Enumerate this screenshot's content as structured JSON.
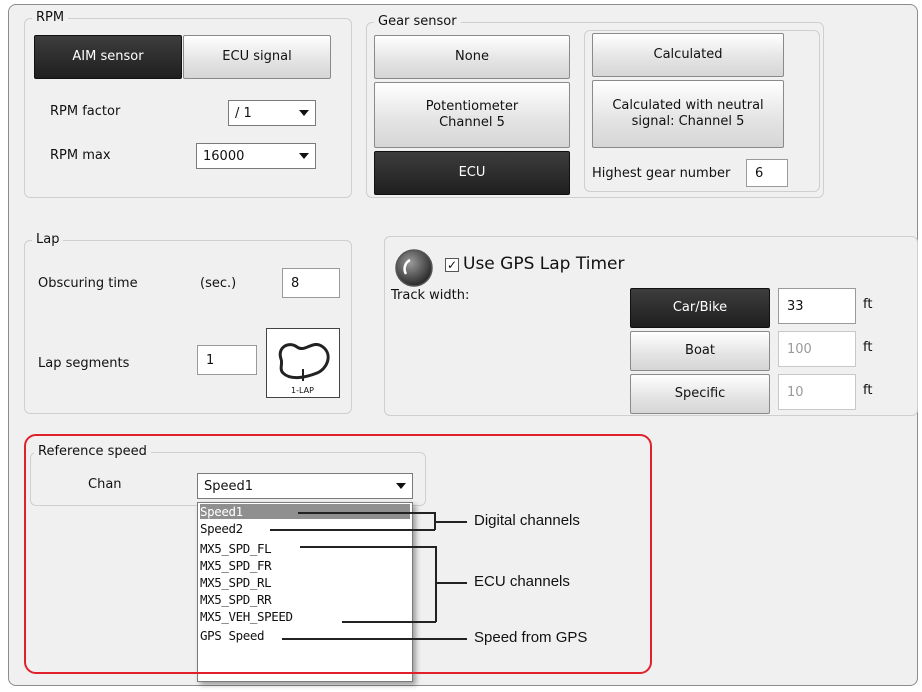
{
  "rpm": {
    "title": "RPM",
    "aim_sensor": "AIM sensor",
    "ecu_signal": "ECU signal",
    "factor_label": "RPM factor",
    "factor_value": "/ 1",
    "max_label": "RPM max",
    "max_value": "16000"
  },
  "gear": {
    "title": "Gear sensor",
    "none": "None",
    "potentiometer": "Potentiometer\nChannel 5",
    "ecu": "ECU",
    "calculated": "Calculated",
    "calculated_neutral": "Calculated with neutral\nsignal: Channel 5",
    "highest_label": "Highest gear number",
    "highest_value": "6"
  },
  "lap": {
    "title": "Lap",
    "obscuring_label": "Obscuring time",
    "obscuring_unit": "(sec.)",
    "obscuring_value": "8",
    "segments_label": "Lap segments",
    "segments_value": "1",
    "icon_caption": "1-LAP"
  },
  "gps": {
    "use_label": "Use GPS Lap Timer",
    "checked": true,
    "track_width_label": "Track width:",
    "rows": [
      {
        "label": "Car/Bike",
        "value": "33",
        "unit": "ft"
      },
      {
        "label": "Boat",
        "value": "100",
        "unit": "ft"
      },
      {
        "label": "Specific",
        "value": "10",
        "unit": "ft"
      }
    ]
  },
  "reference_speed": {
    "title": "Reference speed",
    "chan_label": "Chan",
    "selected": "Speed1",
    "options": [
      "Speed1",
      "Speed2",
      "MX5_SPD_FL",
      "MX5_SPD_FR",
      "MX5_SPD_RL",
      "MX5_SPD_RR",
      "MX5_VEH_SPEED",
      "GPS Speed"
    ]
  },
  "annotations": {
    "digital": "Digital channels",
    "ecu": "ECU channels",
    "gps": "Speed from GPS"
  },
  "colors": {
    "highlight": "#e0202a",
    "active_button": "#2a2a2a"
  }
}
